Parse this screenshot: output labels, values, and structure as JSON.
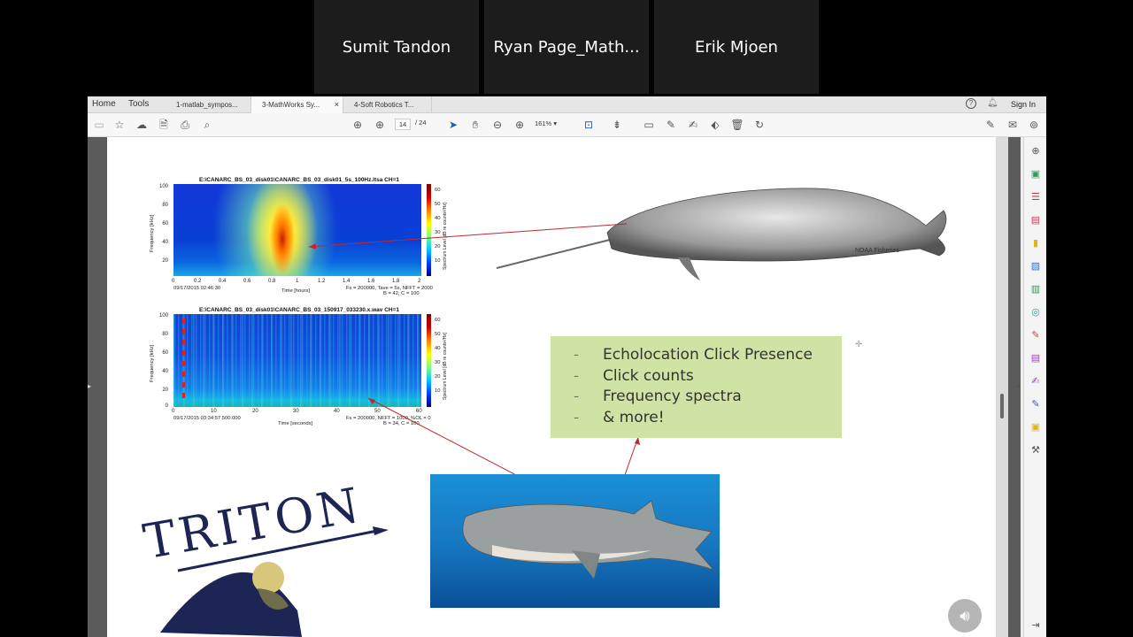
{
  "participants": [
    "Sumit Tandon",
    "Ryan Page_Math...",
    "Erik Mjoen"
  ],
  "menu": {
    "home": "Home",
    "tools": "Tools"
  },
  "tabs": [
    {
      "label": "1-matlab_sympos..."
    },
    {
      "label": "3-MathWorks Sy...",
      "close": "×"
    },
    {
      "label": "4-Soft Robotics T..."
    }
  ],
  "account": {
    "sign_in": "Sign In"
  },
  "toolbar": {
    "page_current": "14",
    "page_total": "/ 24",
    "zoom": "161%"
  },
  "slide": {
    "spec1": {
      "title": "E:\\CANARC_BS_03_disk01\\CANARC_BS_03_disk01_5s_100Hz.ltsa CH=1",
      "yticks": [
        "100",
        "80",
        "60",
        "40",
        "20"
      ],
      "xticks": [
        "0",
        "0.2",
        "0.4",
        "0.6",
        "0.8",
        "1",
        "1.2",
        "1.4",
        "1.6",
        "1.8",
        "2"
      ],
      "ylabel": "Frequency [kHz]",
      "xlabel": "Time [hours]",
      "date": "09/17/2015 02:46:30",
      "params1": "Fs = 200000, Tave = 5s, NFFT = 2000",
      "params2": "B = 42, C = 100",
      "cbar_ticks": [
        "60",
        "50",
        "40",
        "30",
        "20",
        "10"
      ],
      "cbar_label": "Spectrum Level [dB re counts²/Hz]"
    },
    "spec2": {
      "title": "E:\\CANARC_BS_03_disk01\\CANARC_BS_03_150917_033230.x.wav CH=1",
      "yticks": [
        "100",
        "80",
        "60",
        "40",
        "20",
        "0"
      ],
      "xticks": [
        "0",
        "10",
        "20",
        "30",
        "40",
        "50",
        "60"
      ],
      "ylabel": "Frequency [kHz]",
      "xlabel": "Time [seconds]",
      "date": "09/17/2015 03:34:57.500.000",
      "params1": "Fs = 200000, NFFT = 1000, %OL = 0",
      "params2": "B = 34, C = 100",
      "cbar_ticks": [
        "60",
        "50",
        "40",
        "30",
        "20",
        "10"
      ],
      "cbar_label": "Spectrum Level [dB re counts²/Hz]"
    },
    "noaa": "NOAA Fisheries",
    "bullets": [
      "Echolocation Click Presence",
      "Click counts",
      "Frequency spectra",
      "& more!"
    ],
    "bullet_mark": "-",
    "logo": "TRITON"
  },
  "colors": {
    "callout": "#cfe3a4",
    "ocean": "#1e7fc8",
    "arrow": "#c0282d"
  }
}
